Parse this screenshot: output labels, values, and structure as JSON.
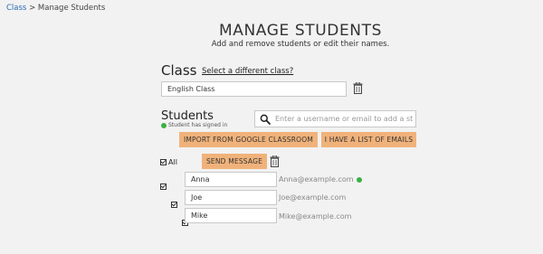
{
  "breadcrumb": {
    "link": "Class",
    "separator": ">",
    "current": "Manage Students"
  },
  "header": {
    "title": "MANAGE STUDENTS",
    "subtitle": "Add and remove students or edit their names."
  },
  "class_section": {
    "label": "Class",
    "change_link": "Select a different class?",
    "class_name": "English Class"
  },
  "students_section": {
    "label": "Students",
    "signed_in_legend": "Student has signed in",
    "search_placeholder": "Enter a username or email to add a stud...",
    "import_button": "IMPORT FROM GOOGLE CLASSROOM",
    "list_button": "I HAVE A LIST OF EMAILS",
    "select_all_label": "All",
    "send_message_button": "SEND MESSAGE",
    "students": [
      {
        "name": "Anna",
        "email": "Anna@example.com",
        "signed_in": true,
        "checked": true
      },
      {
        "name": "Joe",
        "email": "Joe@example.com",
        "signed_in": false,
        "checked": true
      },
      {
        "name": "Mike",
        "email": "Mike@example.com",
        "signed_in": false,
        "checked": true
      }
    ]
  },
  "colors": {
    "accent_button": "#f0b27a",
    "signed_in_dot": "#3cb043",
    "link": "#2a6bb5"
  }
}
